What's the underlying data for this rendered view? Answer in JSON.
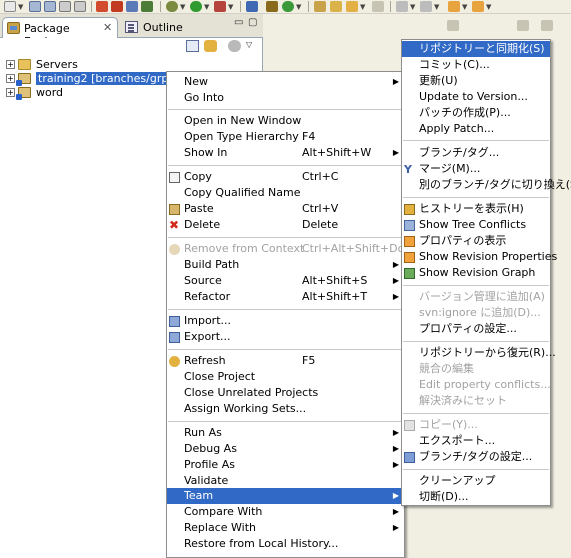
{
  "views": {
    "package_explorer_tab": "Package Explorer",
    "outline_tab": "Outline"
  },
  "tree": [
    {
      "label": "Servers",
      "icon": "folder-icon",
      "expander": "+"
    },
    {
      "label": "training2 [branches/grp2/trai",
      "icon": "project-icon",
      "expander": "+",
      "selected": true
    },
    {
      "label": "word",
      "icon": "project-icon",
      "expander": "+"
    }
  ],
  "context_menu": {
    "new": "New",
    "go_into": "Go Into",
    "open_in_new_window": "Open in New Window",
    "open_type_hierarchy": "Open Type Hierarchy",
    "open_type_hierarchy_accel": "F4",
    "show_in": "Show In",
    "show_in_accel": "Alt+Shift+W",
    "copy": "Copy",
    "copy_accel": "Ctrl+C",
    "copy_qualified_name": "Copy Qualified Name",
    "paste": "Paste",
    "paste_accel": "Ctrl+V",
    "delete": "Delete",
    "delete_accel": "Delete",
    "remove_from_context": "Remove from Context",
    "remove_from_context_accel": "Ctrl+Alt+Shift+Down",
    "build_path": "Build Path",
    "source": "Source",
    "source_accel": "Alt+Shift+S",
    "refactor": "Refactor",
    "refactor_accel": "Alt+Shift+T",
    "import": "Import...",
    "export": "Export...",
    "refresh": "Refresh",
    "refresh_accel": "F5",
    "close_project": "Close Project",
    "close_unrelated_projects": "Close Unrelated Projects",
    "assign_working_sets": "Assign Working Sets...",
    "run_as": "Run As",
    "debug_as": "Debug As",
    "profile_as": "Profile As",
    "validate": "Validate",
    "team": "Team",
    "compare_with": "Compare With",
    "replace_with": "Replace With",
    "restore_from_local_history": "Restore from Local History..."
  },
  "team_menu": {
    "sync_with_repository": "リポジトリーと同期化(S)",
    "commit": "コミット(C)...",
    "update": "更新(U)",
    "update_to_version": "Update to Version...",
    "create_patch": "パッチの作成(P)...",
    "apply_patch": "Apply Patch...",
    "branch_tag": "ブランチ/タグ...",
    "merge": "マージ(M)...",
    "switch_branch_tag": "別のブランチ/タグに切り換え(S)...",
    "show_history": "ヒストリーを表示(H)",
    "show_tree_conflicts": "Show Tree Conflicts",
    "show_properties": "プロパティの表示",
    "show_revision_properties": "Show Revision Properties",
    "show_revision_graph": "Show Revision Graph",
    "add_to_version_control": "バージョン管理に追加(A)",
    "add_to_svn_ignore": "svn:ignore に追加(D)...",
    "set_property": "プロパティの設定...",
    "revert": "リポジトリーから復元(R)...",
    "edit_conflicts": "競合の編集",
    "edit_property_conflicts": "Edit property conflicts...",
    "mark_resolved": "解決済みにセット",
    "copy": "コピー(Y)...",
    "export": "エクスポート...",
    "configure_branch_tag": "ブランチ/タグの設定...",
    "cleanup": "クリーンアップ",
    "disconnect": "切断(D)..."
  }
}
